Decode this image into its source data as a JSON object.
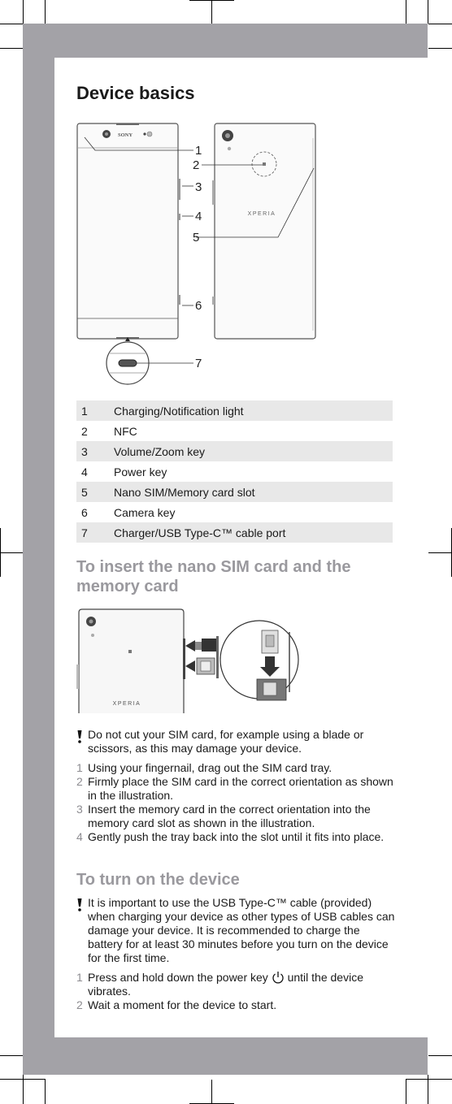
{
  "heading": "Device basics",
  "figure1": {
    "callouts": [
      "1",
      "2",
      "3",
      "4",
      "5",
      "6",
      "7"
    ],
    "front_brand": "SONY",
    "back_brand": "XPERIA"
  },
  "parts": [
    {
      "num": "1",
      "label": "Charging/Notification light"
    },
    {
      "num": "2",
      "label": "NFC"
    },
    {
      "num": "3",
      "label": "Volume/Zoom key"
    },
    {
      "num": "4",
      "label": "Power key"
    },
    {
      "num": "5",
      "label": "Nano SIM/Memory card slot"
    },
    {
      "num": "6",
      "label": "Camera key"
    },
    {
      "num": "7",
      "label": "Charger/USB Type-C™ cable port"
    }
  ],
  "sim_section": {
    "title_line1": "To insert the nano SIM card and the",
    "title_line2": "memory card",
    "figure_brand": "XPERIA",
    "note": "Do not cut your SIM card, for example using a blade or scissors, as this may damage your device.",
    "steps": [
      {
        "n": "1",
        "text": "Using your fingernail, drag out the SIM card tray."
      },
      {
        "n": "2",
        "text": "Firmly place the SIM card in the correct orientation as shown in the illustration."
      },
      {
        "n": "3",
        "text": "Insert the memory card in the correct orientation into the memory card slot as shown in the illustration."
      },
      {
        "n": "4",
        "text": "Gently push the tray back into the slot until it fits into place."
      }
    ]
  },
  "power_section": {
    "title": "To turn on the device",
    "note": "It is important to use the USB Type-C™ cable (provided) when charging your device as other types of USB cables can damage your device. It is recommended to charge the battery for at least 30 minutes before you turn on the device for the first time.",
    "steps": [
      {
        "n": "1",
        "text_before": "Press and hold down the power key",
        "icon": "power-icon",
        "text_after": "until the device vibrates."
      },
      {
        "n": "2",
        "text": "Wait a moment for the device to start."
      }
    ]
  },
  "colors": {
    "frame_gray": "#a3a2a7",
    "heading_gray": "#9a999e",
    "row_shade": "#e8e8e8"
  }
}
